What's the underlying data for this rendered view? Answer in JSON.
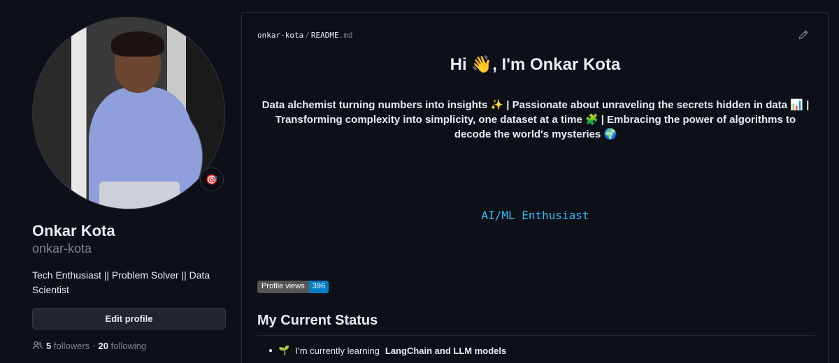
{
  "profile": {
    "status_emoji": "🎯",
    "name": "Onkar Kota",
    "login": "onkar-kota",
    "bio": "Tech Enthusiast || Problem Solver || Data Scientist",
    "edit_profile_label": "Edit profile",
    "followers_count": "5",
    "followers_label": "followers",
    "separator": "·",
    "following_count": "20",
    "following_label": "following"
  },
  "readme": {
    "owner": "onkar-kota",
    "path_separator": "/",
    "filename": "README",
    "extension": ".md",
    "greeting": "Hi 👋, I'm Onkar Kota",
    "tagline": "Data alchemist turning numbers into insights ✨ | Passionate about unraveling the secrets hidden in data 📊 | Transforming complexity into simplicity, one dataset at a time 🧩 | Embracing the power of algorithms to decode the world's mysteries 🌍",
    "typing_text": "AI/ML Enthusiast",
    "views_badge": {
      "label": "Profile views",
      "count": "396"
    },
    "section_title": "My Current Status",
    "status_items": [
      {
        "emoji": "🌱",
        "text": "I’m currently learning",
        "bold": "LangChain and LLM models"
      }
    ]
  },
  "colors": {
    "background": "#0d1117",
    "border": "#30363d",
    "muted": "#7d8590",
    "typing_accent": "#36bcf7",
    "badge_count": "#007ec6"
  },
  "icons": [
    "status-target-icon",
    "people-icon",
    "pencil-icon"
  ]
}
